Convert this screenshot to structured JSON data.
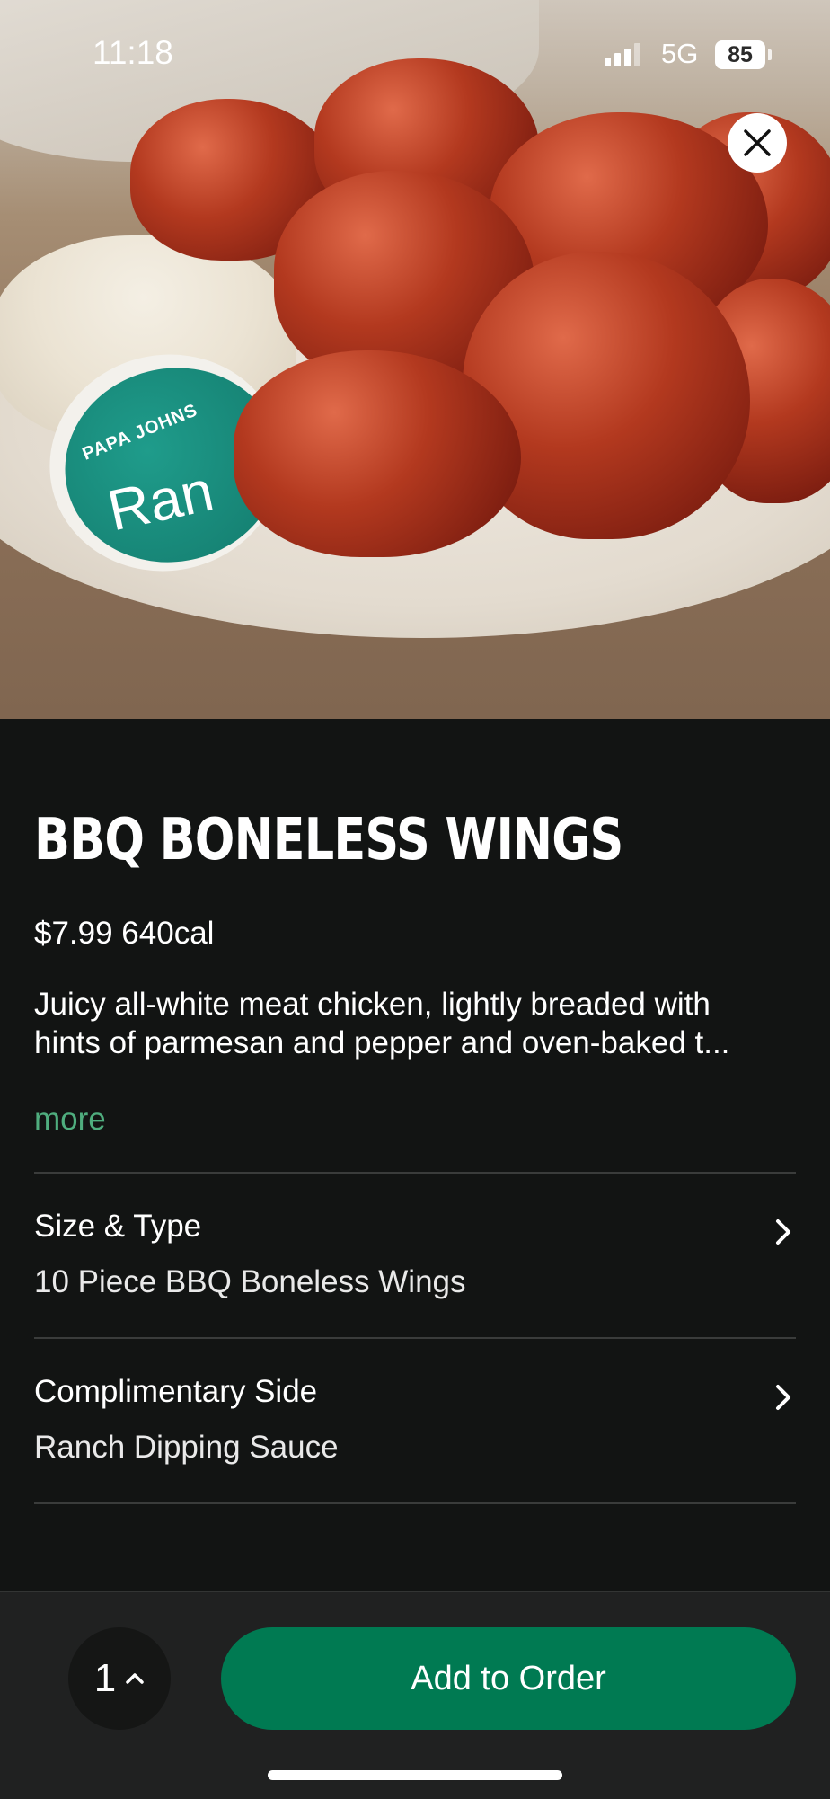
{
  "status_bar": {
    "time": "11:18",
    "network": "5G",
    "battery": "85"
  },
  "hero": {
    "image_icon": "wings-photo",
    "lid_brand": "PAPA JOHNS",
    "lid_label": "Ran",
    "close_icon": "close-icon"
  },
  "item": {
    "title": "BBQ BONELESS WINGS",
    "price_cal": "$7.99 640cal",
    "description_line1": "Juicy all-white meat chicken, lightly breaded with",
    "description_line2": "hints of parmesan and pepper and oven-baked t...",
    "more_label": "more"
  },
  "options": [
    {
      "label": "Size & Type",
      "value": "10 Piece BBQ Boneless Wings"
    },
    {
      "label": "Complimentary Side",
      "value": "Ranch Dipping Sauce"
    }
  ],
  "footer": {
    "quantity": "1",
    "add_label": "Add to Order"
  },
  "colors": {
    "accent": "#007a52",
    "link": "#4fad7e",
    "background": "#121413"
  }
}
